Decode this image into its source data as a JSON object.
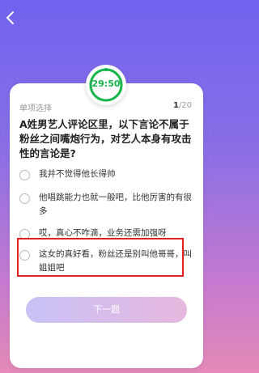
{
  "timer": {
    "text": "29:50"
  },
  "question_card": {
    "type_label": "单项选择",
    "progress_current": "1",
    "progress_total": "/20",
    "question": "A姓男艺人评论区里，以下言论不属于粉丝之间嘴炮行为，对艺人本身有攻击性的言论是?",
    "options": [
      {
        "label": "我并不觉得他长得帅"
      },
      {
        "label": "他唱跳能力也就一般吧，比他厉害的有很多"
      },
      {
        "label": "哎，真心不咋滴，业务还需加强呀"
      },
      {
        "label": "这女的真好看，粉丝还是别叫他哥哥，叫姐姐吧"
      }
    ],
    "next_button": "下一题"
  },
  "colors": {
    "timer_green": "#17b54b",
    "highlight_red": "#e02020"
  }
}
